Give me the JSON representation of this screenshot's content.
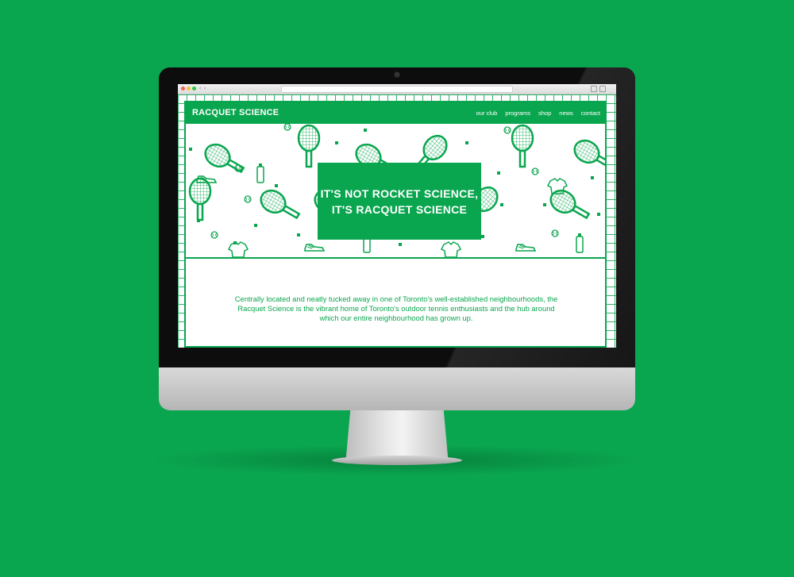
{
  "site": {
    "logo": "RACQUET SCIENCE",
    "nav": [
      "our club",
      "programs",
      "shop",
      "news",
      "contact"
    ],
    "headline": [
      "IT'S NOT ROCKET SCIENCE,",
      "IT'S RACQUET SCIENCE"
    ],
    "intro": "Centrally located and neatly tucked away in one of Toronto's well-established neighbourhoods, the Racquet Science is the vibrant home of Toronto's outdoor tennis enthusiasts and the hub around which our entire neighbourhood has grown up."
  },
  "colors": {
    "brand": "#0aa64f",
    "background": "#0aa64f",
    "text_on_brand": "#ffffff"
  },
  "icons": [
    "tennis-racquet-icon",
    "tennis-ball-icon",
    "sneaker-icon",
    "polo-shirt-icon",
    "water-bottle-icon"
  ]
}
